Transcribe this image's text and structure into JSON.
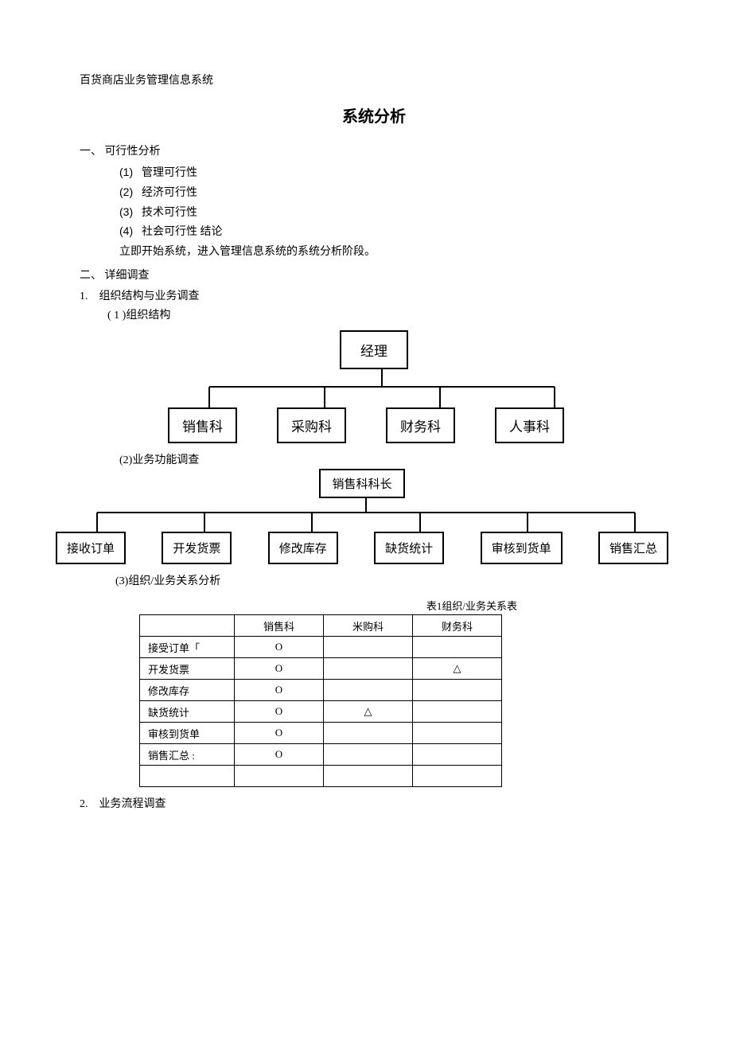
{
  "header": "百货商店业务管理信息系统",
  "title": "系统分析",
  "sec1": {
    "heading": "一、 可行性分析",
    "items": [
      {
        "n": "(1)",
        "t": "管理可行性"
      },
      {
        "n": "(2)",
        "t": "经济可行性"
      },
      {
        "n": "(3)",
        "t": "技术可行性"
      },
      {
        "n": "(4)",
        "t": "社会可行性  结论"
      }
    ],
    "conclusion": "立即开始系统，进入管理信息系统的系统分析阶段。"
  },
  "sec2": {
    "heading": "二、 详细调查",
    "sub1": {
      "heading": "1.　组织结构与业务调查",
      "p1": {
        "label": "( 1 )组织结构"
      },
      "chart1": {
        "top": "经理",
        "children": [
          "销售科",
          "采购科",
          "财务科",
          "人事科"
        ]
      },
      "p2": {
        "label": "(2)业务功能调查"
      },
      "chart2": {
        "top": "销售科科长",
        "children": [
          "接收订单",
          "开发货票",
          "修改库存",
          "缺货统计",
          "审核到货单",
          "销售汇总"
        ]
      },
      "p3": {
        "label": "(3)组织/业务关系分析"
      },
      "table": {
        "caption": "表1组织/业务关系表",
        "cols": [
          "销售科",
          "米购科",
          "财务科"
        ],
        "rows": [
          {
            "label": "接受订单「",
            "cells": [
              "O",
              "",
              ""
            ]
          },
          {
            "label": "开发货票",
            "cells": [
              "O",
              "",
              "△"
            ]
          },
          {
            "label": "修改库存",
            "cells": [
              "O",
              "",
              ""
            ]
          },
          {
            "label": "缺货统计",
            "cells": [
              "O",
              "△",
              ""
            ]
          },
          {
            "label": "审核到货单",
            "cells": [
              "O",
              "",
              ""
            ]
          },
          {
            "label": "销售汇总   :",
            "cells": [
              "O",
              "",
              ""
            ]
          },
          {
            "label": "",
            "cells": [
              "",
              "",
              ""
            ]
          }
        ]
      }
    },
    "sub2": {
      "heading": "2.　业务流程调查"
    }
  }
}
